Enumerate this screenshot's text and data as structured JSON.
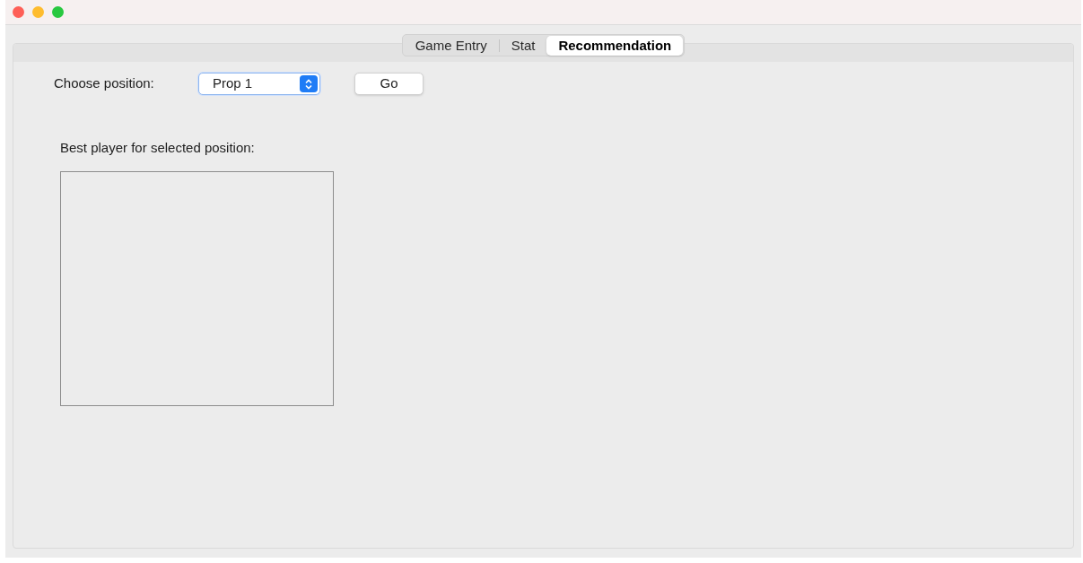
{
  "tabs": [
    {
      "label": "Game Entry",
      "selected": false
    },
    {
      "label": "Stat",
      "selected": false
    },
    {
      "label": "Recommendation",
      "selected": true
    }
  ],
  "position_select": {
    "label": "Choose position:",
    "value": "Prop 1"
  },
  "go_button": "Go",
  "result": {
    "label": "Best player for selected position:"
  }
}
